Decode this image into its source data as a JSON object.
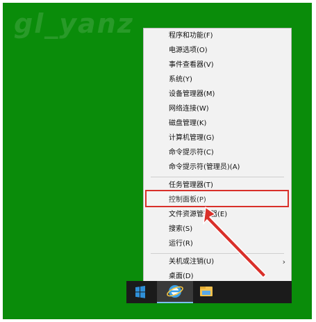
{
  "watermark": "gl_yanz",
  "menu": {
    "items": [
      {
        "label": "程序和功能(F)"
      },
      {
        "label": "电源选项(O)"
      },
      {
        "label": "事件查看器(V)"
      },
      {
        "label": "系统(Y)"
      },
      {
        "label": "设备管理器(M)"
      },
      {
        "label": "网络连接(W)"
      },
      {
        "label": "磁盘管理(K)"
      },
      {
        "label": "计算机管理(G)"
      },
      {
        "label": "命令提示符(C)"
      },
      {
        "label": "命令提示符(管理员)(A)"
      },
      {
        "label": "任务管理器(T)"
      },
      {
        "label": "控制面板(P)"
      },
      {
        "label": "文件资源管理器(E)"
      },
      {
        "label": "搜索(S)"
      },
      {
        "label": "运行(R)"
      },
      {
        "label": "关机或注销(U)"
      },
      {
        "label": "桌面(D)"
      }
    ],
    "submenu_arrow": "›"
  },
  "taskbar": {
    "start_icon": "windows-logo-icon",
    "pinned": [
      "internet-explorer-icon",
      "file-explorer-icon"
    ]
  },
  "colors": {
    "desktop": "#0a8c0a",
    "highlight_border": "#d9302a",
    "arrow": "#d9302a",
    "menu_bg": "#f2f2f2",
    "taskbar": "#1b1b1b"
  }
}
